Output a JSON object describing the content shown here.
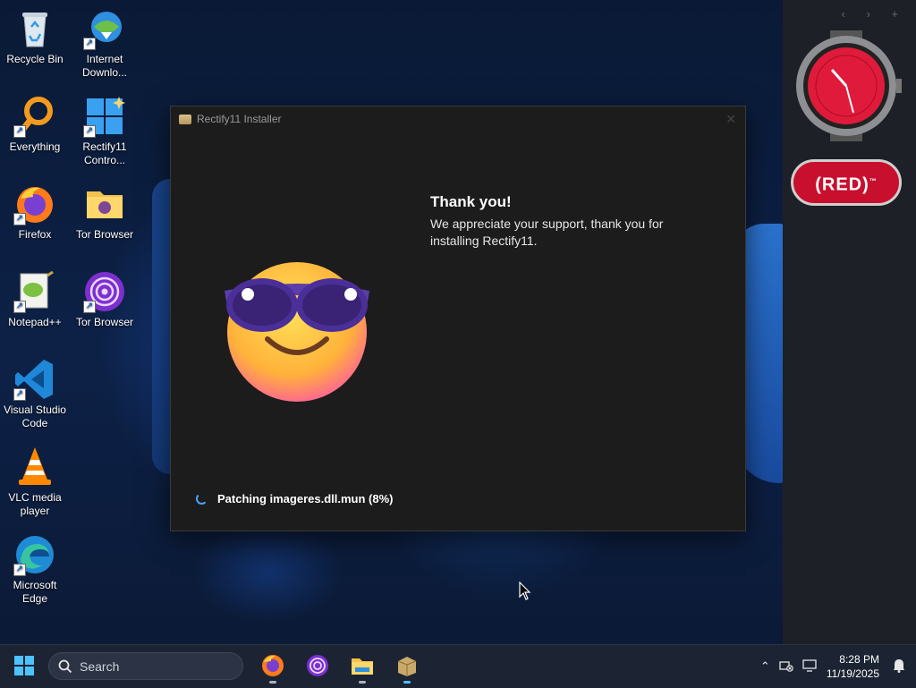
{
  "desktop": {
    "icons": [
      {
        "label": "Recycle Bin"
      },
      {
        "label": "Internet Downlo..."
      },
      {
        "label": "Everything"
      },
      {
        "label": "Rectify11 Contro..."
      },
      {
        "label": "Firefox"
      },
      {
        "label": "Tor Browser"
      },
      {
        "label": "Notepad++"
      },
      {
        "label": "Tor Browser"
      },
      {
        "label": "Visual Studio Code"
      },
      {
        "label": "VLC media player"
      },
      {
        "label": "Microsoft Edge"
      }
    ]
  },
  "gadgets": {
    "nav": "‹ › +",
    "red_badge": "(RED)",
    "red_badge_mark": "™"
  },
  "installer": {
    "title": "Rectify11 Installer",
    "heading": "Thank you!",
    "message": "We appreciate your support, thank you for installing Rectify11.",
    "status": "Patching imageres.dll.mun (8%)",
    "progress_percent": 8
  },
  "taskbar": {
    "search_placeholder": "Search",
    "time": "8:28 PM",
    "date": "11/19/2025",
    "apps": [
      "firefox",
      "tor-browser",
      "file-explorer",
      "installer"
    ]
  },
  "colors": {
    "accent": "#4aa3ff",
    "window_bg": "#1c1c1c",
    "taskbar_bg": "#1c2433",
    "red_badge": "#c8102e"
  }
}
